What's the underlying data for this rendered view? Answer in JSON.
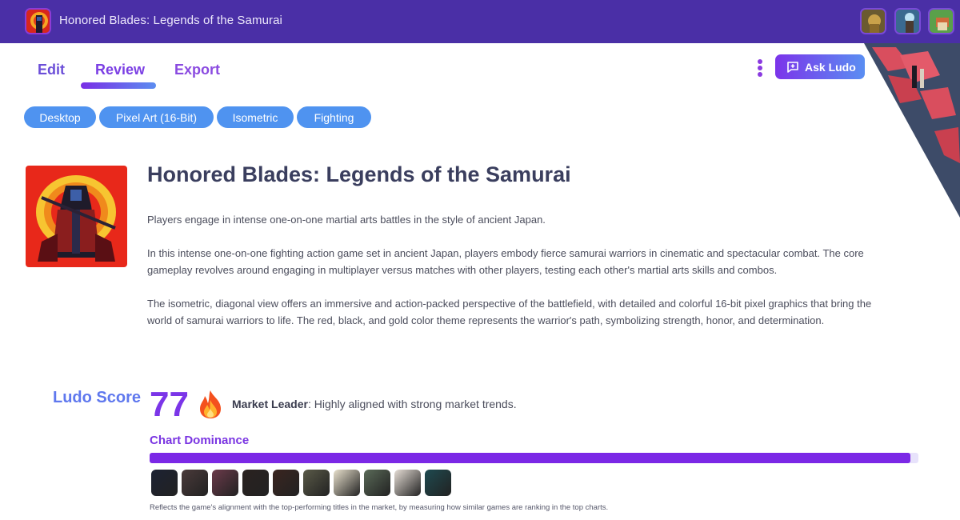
{
  "header": {
    "app_title": "Honored Blades: Legends of the Samurai",
    "recent_projects": [
      {
        "name": "golden-warrior-project"
      },
      {
        "name": "magic-tower-project"
      },
      {
        "name": "village-builder-project"
      }
    ]
  },
  "tabs": [
    {
      "label": "Edit",
      "active": false
    },
    {
      "label": "Review",
      "active": true
    },
    {
      "label": "Export",
      "active": false
    }
  ],
  "toolbar": {
    "more_menu_icon": "kebab-vertical",
    "ask_button_icon": "chat-plus-icon",
    "ask_button_label": "Ask Ludo"
  },
  "tags": [
    "Desktop",
    "Pixel Art (16-Bit)",
    "Isometric",
    "Fighting"
  ],
  "game": {
    "title": "Honored Blades: Legends of the Samurai",
    "summary": "Players engage in intense one-on-one martial arts battles in the style of ancient Japan.",
    "description_1": "In this intense one-on-one fighting action game set in ancient Japan, players embody fierce samurai warriors in cinematic and spectacular combat. The core gameplay revolves around engaging in multiplayer versus matches with other players, testing each other's martial arts skills and combos.",
    "description_2": "The isometric, diagonal view offers an immersive and action-packed perspective of the battlefield, with detailed and colorful 16-bit pixel graphics that bring the world of samurai warriors to life. The red, black, and gold color theme represents the warrior's path, symbolizing strength, honor, and determination."
  },
  "score": {
    "label": "Ludo Score",
    "value": "77",
    "icon": "fire-icon",
    "tier": "Market Leader",
    "tier_suffix": ": Highly aligned with strong market trends.",
    "chart_dominance_label": "Chart Dominance",
    "chart_dominance_fraction": 0.99,
    "similar_titles": [
      {
        "name": "similar-game-1",
        "color": "#1c2233"
      },
      {
        "name": "similar-game-2",
        "color": "#4a3a3a"
      },
      {
        "name": "similar-game-3",
        "color": "#6b3a4a"
      },
      {
        "name": "similar-game-4",
        "color": "#2a2220"
      },
      {
        "name": "similar-game-5",
        "color": "#3a2520"
      },
      {
        "name": "similar-game-6",
        "color": "#5a5a48"
      },
      {
        "name": "similar-game-7",
        "color": "#e8e0cc"
      },
      {
        "name": "similar-game-8",
        "color": "#5a6a58"
      },
      {
        "name": "similar-game-9",
        "color": "#e5ddd5"
      },
      {
        "name": "similar-game-10",
        "color": "#1e4a50"
      }
    ],
    "footnote": "Reflects the game's alignment with the top-performing titles in the market, by measuring how similar games are ranking in the top charts."
  }
}
